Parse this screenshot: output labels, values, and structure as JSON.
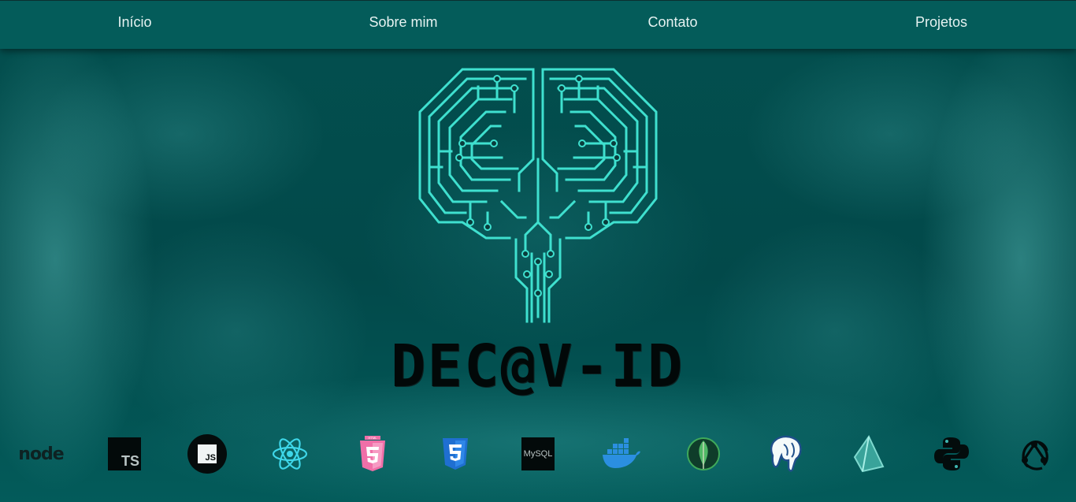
{
  "nav": {
    "items": [
      "Início",
      "Sobre mim",
      "Contato",
      "Projetos"
    ]
  },
  "hero": {
    "logo_text": "DEC@V-ID"
  },
  "tech": {
    "node": "node",
    "ts": "TS",
    "js": "JS",
    "html": "HTML",
    "mysql": "MySQL",
    "icons": [
      "nodejs-icon",
      "typescript-icon",
      "javascript-icon",
      "react-icon",
      "html5-icon",
      "css3-icon",
      "mysql-icon",
      "docker-icon",
      "mongodb-icon",
      "postgresql-icon",
      "prisma-icon",
      "python-icon",
      "redux-icon"
    ]
  },
  "colors": {
    "nav_bg": "#045c5a",
    "page_bg": "#024e4e",
    "brain": "#3fe0cf"
  }
}
